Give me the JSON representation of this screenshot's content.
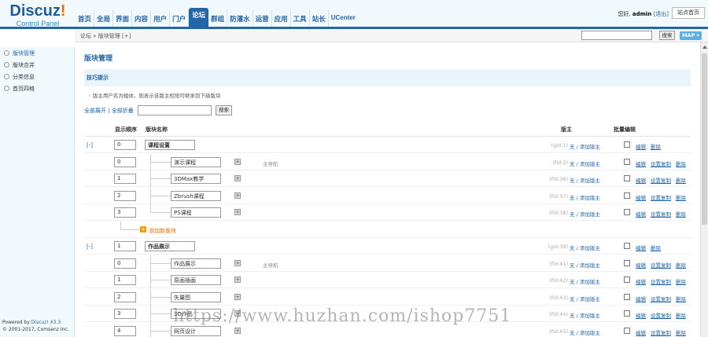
{
  "header": {
    "brand_main": "Discuz",
    "brand_mark": "!",
    "brand_sub": "Control Panel",
    "tabs": [
      "首页",
      "全局",
      "界面",
      "内容",
      "用户",
      "门户",
      "论坛",
      "群组",
      "防灌水",
      "运营",
      "应用",
      "工具",
      "站长",
      "UCenter"
    ],
    "active_tab": "论坛",
    "user_greeting": "您好,",
    "user_name": "admin",
    "logout": "[退出]",
    "home_button": "站点首页"
  },
  "subbar": {
    "breadcrumb": "论坛 » 版块管理  [+]",
    "search_button": "搜索",
    "map_button": "MAP ▾"
  },
  "sidebar": {
    "items": [
      "版块管理",
      "版块合并",
      "分类信息",
      "首页四格"
    ],
    "active": "版块管理",
    "footer_line1": "Powered by ",
    "footer_brand": "Discuz! X3.3",
    "footer_line2": "© 2001-2017, Comsenz Inc."
  },
  "main": {
    "title": "版块管理",
    "tips_title": "技巧提示",
    "tip": "版主用户名为粗体，则表示该版主权限可继承到下级版块",
    "expand_all": "全部展开",
    "collapse_all": "全部折叠",
    "search_button": "搜索",
    "columns": {
      "order": "显示顺序",
      "name": "版块名称",
      "moderator": "版主",
      "batch": "批量编辑"
    },
    "add_forum": "添加新版块"
  },
  "rows": [
    {
      "type": "group",
      "toggle": "[-]",
      "order": "0",
      "name": "课程设置",
      "fid": "(gid:1)",
      "mod": "无 / 添加版主",
      "acts": [
        "编辑",
        "删除"
      ]
    },
    {
      "type": "forum",
      "order": "0",
      "name": "演示课程",
      "badge": "主导航",
      "fid": "(fid:2)",
      "mod": "无 / 添加版主",
      "acts": [
        "编辑",
        "设置复制",
        "删除"
      ]
    },
    {
      "type": "forum",
      "order": "1",
      "name": "3DMax教学",
      "badge": "",
      "fid": "(fid:36)",
      "mod": "无 / 添加版主",
      "acts": [
        "编辑",
        "设置复制",
        "删除"
      ]
    },
    {
      "type": "forum",
      "order": "2",
      "name": "Zbrush课程",
      "badge": "",
      "fid": "(fid:37)",
      "mod": "无 / 添加版主",
      "acts": [
        "编辑",
        "设置复制",
        "删除"
      ]
    },
    {
      "type": "forum",
      "order": "3",
      "name": "PS课程",
      "badge": "",
      "fid": "(fid:38)",
      "mod": "无 / 添加版主",
      "acts": [
        "编辑",
        "设置复制",
        "删除"
      ],
      "last": true
    },
    {
      "type": "add"
    },
    {
      "type": "group",
      "toggle": "[-]",
      "order": "1",
      "name": "作品展示",
      "fid": "(gid:39)",
      "mod": "无 / 添加版主",
      "acts": [
        "编辑",
        "删除"
      ]
    },
    {
      "type": "forum",
      "order": "0",
      "name": "作品展示",
      "badge": "主导航",
      "fid": "(fid:41)",
      "mod": "无 / 添加版主",
      "acts": [
        "编辑",
        "设置复制",
        "删除"
      ]
    },
    {
      "type": "forum",
      "order": "1",
      "name": "原画插画",
      "badge": "",
      "fid": "(fid:42)",
      "mod": "无 / 添加版主",
      "acts": [
        "编辑",
        "设置复制",
        "删除"
      ]
    },
    {
      "type": "forum",
      "order": "2",
      "name": "矢量图",
      "badge": "",
      "fid": "(fid:43)",
      "mod": "无 / 添加版主",
      "acts": [
        "编辑",
        "设置复制",
        "删除"
      ]
    },
    {
      "type": "forum",
      "order": "3",
      "name": "3D作品",
      "badge": "",
      "fid": "(fid:44)",
      "mod": "无 / 添加版主",
      "acts": [
        "编辑",
        "设置复制",
        "删除"
      ]
    },
    {
      "type": "forum",
      "order": "4",
      "name": "网页设计",
      "badge": "",
      "fid": "(fid:45)",
      "mod": "无 / 添加版主",
      "acts": [
        "编辑",
        "设置复制",
        "删除"
      ]
    }
  ],
  "watermark": "https://www.huzhan.com/ishop7751"
}
